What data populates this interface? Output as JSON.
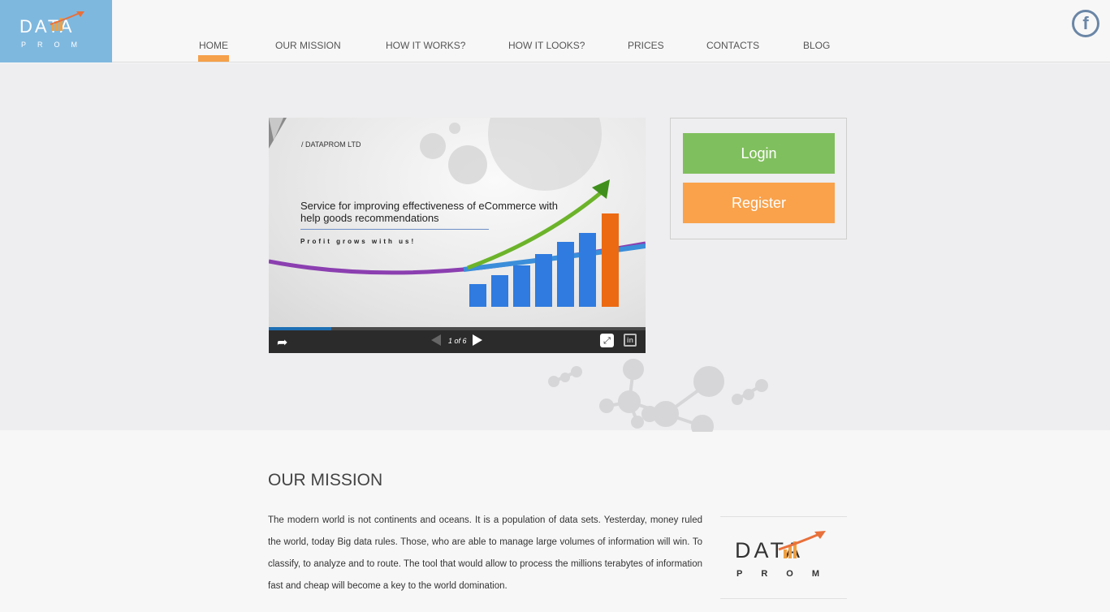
{
  "brand": {
    "logo_text": "DATA",
    "logo_subtext": "PROM",
    "logo_color": "#7fb8df"
  },
  "nav": {
    "items": [
      {
        "label": "HOME",
        "active": true
      },
      {
        "label": "OUR MISSION"
      },
      {
        "label": "HOW IT WORKS?"
      },
      {
        "label": "HOW IT LOOKS?"
      },
      {
        "label": "PRICES"
      },
      {
        "label": "CONTACTS"
      },
      {
        "label": "BLOG"
      }
    ],
    "active_color": "#f5a04a"
  },
  "social": {
    "facebook_glyph": "f",
    "icon": "facebook-icon"
  },
  "slideshow": {
    "company": "/ DATAPROM LTD",
    "headline": "Service for improving effectiveness of eCommerce with help goods recommendations",
    "tagline": "Profit grows with us!",
    "counter": "1 of 6",
    "progress": 0.165,
    "icons": [
      "share-icon",
      "prev-icon",
      "next-icon",
      "fullscreen-icon",
      "linkedin-icon"
    ],
    "linkedin_glyph": "in",
    "fullscreen_glyph": "⤢",
    "share_glyph": "➦"
  },
  "auth": {
    "login_label": "Login",
    "register_label": "Register",
    "login_color": "#80bf5d",
    "register_color": "#f9a24b"
  },
  "mission": {
    "title": "OUR MISSION",
    "text": "The modern world is not continents and oceans. It is a population of data sets. Yesterday, money ruled the world, today Big data rules. Those, who are able to manage large volumes of information will win. To classify, to analyze and to route. The tool that would allow to process the millions terabytes of information fast and cheap will become a key to the world domination.",
    "logo_text": "DATA",
    "logo_subtext": "PROM"
  }
}
